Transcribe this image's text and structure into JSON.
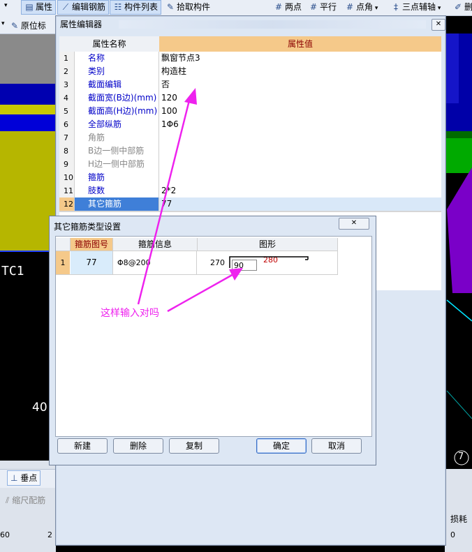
{
  "toolbar": {
    "attr": "属性",
    "edit_rebar": "编辑钢筋",
    "comp_list": "构件列表",
    "pick": "拾取构件",
    "two_point": "两点",
    "parallel": "平行",
    "point_angle": "点角",
    "three_point_aux": "三点辅轴",
    "delete": "删"
  },
  "toolbar2": {
    "origin": "原位标"
  },
  "bg": {
    "label_tc1": "TC1",
    "label_40": "40",
    "dim_60_a": "60",
    "dim_60_b": "60",
    "snap_perp": "垂点",
    "shrink": "缩尺配筋",
    "loss": "损耗",
    "num_60": "60",
    "num_2": "2",
    "num_0": "0",
    "mark_7": "7"
  },
  "prop_editor": {
    "title": "属性编辑器",
    "col_name": "属性名称",
    "col_value": "属性值",
    "rows": [
      {
        "num": "1",
        "name": "名称",
        "value": "飘窗节点3"
      },
      {
        "num": "2",
        "name": "类别",
        "value": "构造柱"
      },
      {
        "num": "3",
        "name": "截面编辑",
        "value": "否"
      },
      {
        "num": "4",
        "name": "截面宽(B边)(mm)",
        "value": "120"
      },
      {
        "num": "5",
        "name": "截面高(H边)(mm)",
        "value": "100"
      },
      {
        "num": "6",
        "name": "全部纵筋",
        "value": "1Φ6"
      },
      {
        "num": "7",
        "name": "角筋",
        "value": ""
      },
      {
        "num": "8",
        "name": "B边一侧中部筋",
        "value": ""
      },
      {
        "num": "9",
        "name": "H边一侧中部筋",
        "value": ""
      },
      {
        "num": "10",
        "name": "箍筋",
        "value": ""
      },
      {
        "num": "11",
        "name": "肢数",
        "value": "2*2"
      },
      {
        "num": "12",
        "name": "其它箍筋",
        "value": "77"
      }
    ]
  },
  "stirrup_dialog": {
    "title": "其它箍筋类型设置",
    "col_no": "箍筋图号",
    "col_info": "箍筋信息",
    "col_shape": "图形",
    "row": {
      "num": "1",
      "no": "77",
      "info": "Φ8@200",
      "left": "270",
      "input": "90",
      "top": "280"
    },
    "new": "新建",
    "delete": "删除",
    "copy": "复制",
    "ok": "确定",
    "cancel": "取消"
  },
  "annotation": {
    "text": "这样输入对吗"
  },
  "colors": {
    "magenta": "#ee22ee",
    "cyan": "#00e5ff",
    "header_orange": "#f5c98a"
  }
}
